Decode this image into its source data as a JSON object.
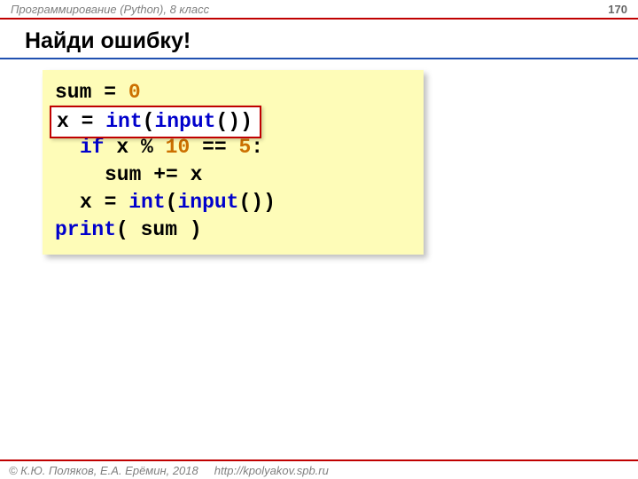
{
  "header": {
    "course": "Программирование (Python), 8 класс",
    "page": "170"
  },
  "title": "Найди ошибку!",
  "code": {
    "l1_sum": "sum",
    "l1_eq": " = ",
    "l1_zero": "0",
    "overlay_x": "x",
    "overlay_eq": " = ",
    "overlay_int": "int",
    "overlay_paren1": "(",
    "overlay_input": "input",
    "overlay_paren2": "())",
    "l3_if": "if",
    "l3_sp": " ",
    "l3_x": "x",
    "l3_mod": " % ",
    "l3_ten": "10",
    "l3_eqeq": " == ",
    "l3_five": "5",
    "l3_colon": ":",
    "l4_sum": "sum",
    "l4_pluseq": " += ",
    "l4_x": "x",
    "l5_x": "x",
    "l5_eq": " = ",
    "l5_int": "int",
    "l5_paren1": "(",
    "l5_input": "input",
    "l5_paren2": "())",
    "l6_print": "print",
    "l6_open": "( ",
    "l6_sum": "sum",
    "l6_close": " )"
  },
  "footer": {
    "copyright": "© К.Ю. Поляков, Е.А. Ерёмин, 2018",
    "url": "http://kpolyakov.spb.ru"
  }
}
